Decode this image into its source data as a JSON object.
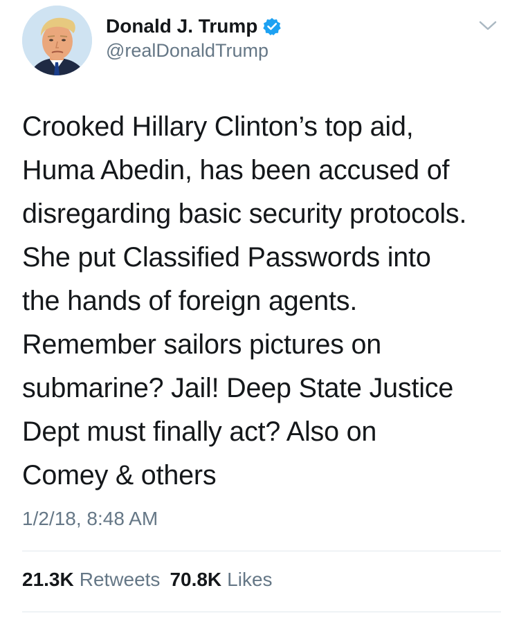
{
  "user": {
    "display_name": "Donald J. Trump",
    "handle": "@realDonaldTrump",
    "verified": true,
    "avatar_icon": "profile-photo"
  },
  "tweet": {
    "text": "Crooked Hillary Clinton’s top aid,\nHuma Abedin, has been accused of\ndisregarding basic security protocols.\nShe put Classified Passwords into\nthe hands of foreign agents.\nRemember sailors pictures on\nsubmarine? Jail! Deep State Justice\nDept must finally act? Also on\nComey & others",
    "timestamp": "1/2/18, 8:48 AM"
  },
  "stats": {
    "retweets_count": "21.3K",
    "retweets_label": "Retweets",
    "likes_count": "70.8K",
    "likes_label": "Likes"
  },
  "colors": {
    "text_primary": "#14171a",
    "text_secondary": "#657786",
    "verified_blue": "#1da1f2",
    "divider": "#e1e8ed"
  },
  "icons": {
    "verified": "verified-badge-icon",
    "more": "chevron-down-icon"
  }
}
